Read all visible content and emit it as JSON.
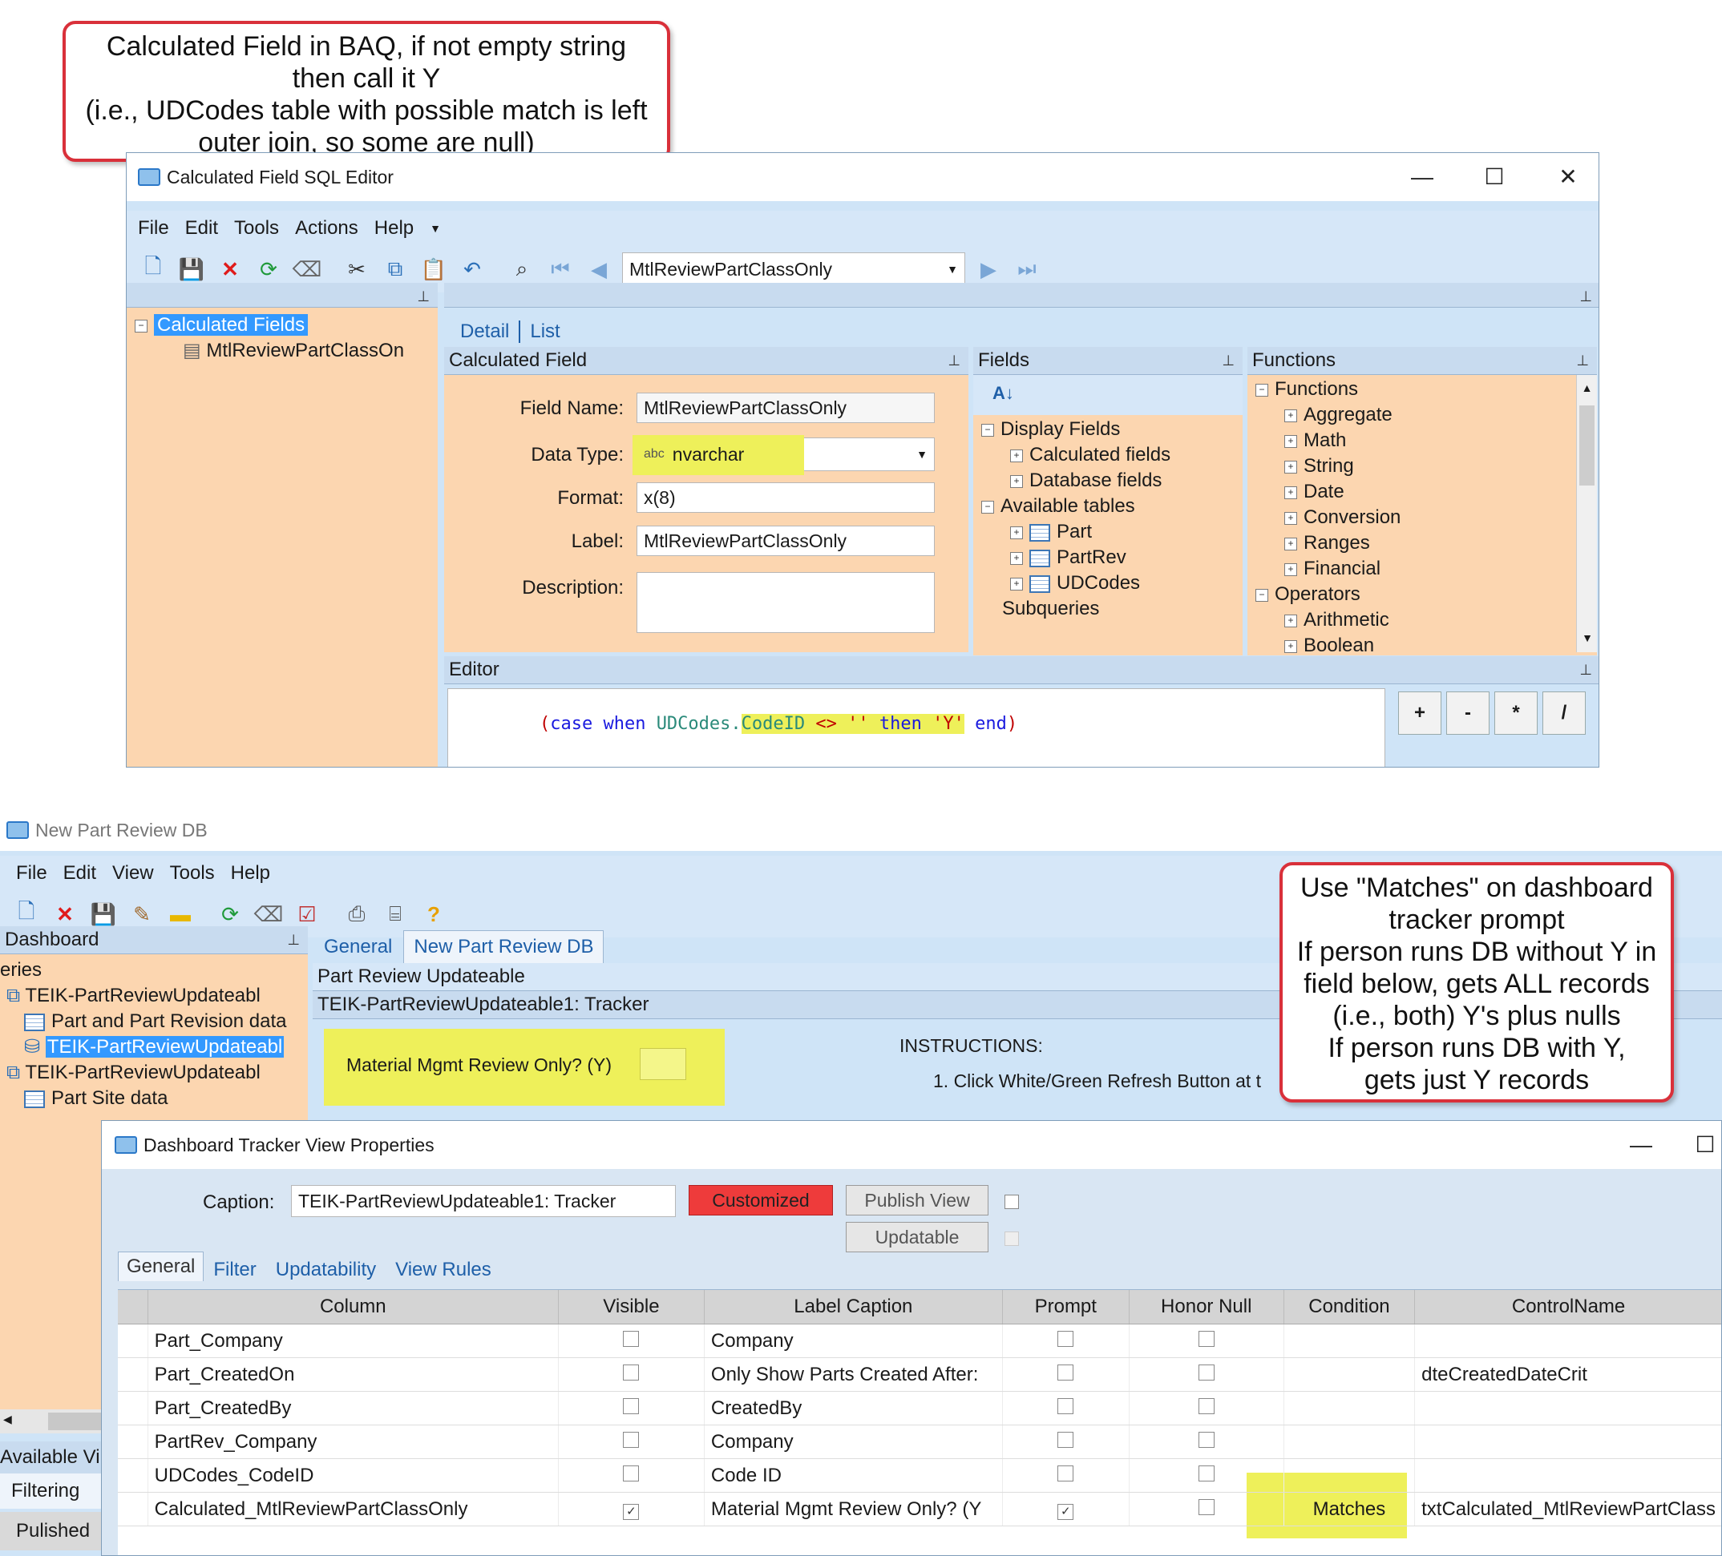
{
  "callout_top": {
    "lines": [
      "Calculated Field in BAQ, if not empty string",
      "then call it Y",
      "(i.e., UDCodes table with possible match is left",
      "outer join, so some are null)"
    ]
  },
  "editor_window": {
    "title": "Calculated Field SQL Editor",
    "menu": [
      "File",
      "Edit",
      "Tools",
      "Actions",
      "Help"
    ],
    "nav_value": "MtlReviewPartClassOnly",
    "tree_root": "Calculated Fields",
    "tree_child": "MtlReviewPartClassOn",
    "tabs": [
      "Detail",
      "List"
    ],
    "calc_panel_title": "Calculated Field",
    "field_name_label": "Field Name:",
    "field_name_value": "MtlReviewPartClassOnly",
    "data_type_label": "Data Type:",
    "data_type_prefix": "abc",
    "data_type_value": "nvarchar",
    "format_label": "Format:",
    "format_value": "x(8)",
    "label_label": "Label:",
    "label_value": "MtlReviewPartClassOnly",
    "description_label": "Description:",
    "fields_panel_title": "Fields",
    "fields_tree": {
      "display_fields": "Display Fields",
      "calculated_fields": "Calculated fields",
      "database_fields": "Database fields",
      "available_tables": "Available tables",
      "tables": [
        "Part",
        "PartRev",
        "UDCodes"
      ],
      "subqueries": "Subqueries"
    },
    "functions_panel_title": "Functions",
    "functions_tree": {
      "root": "Functions",
      "items": [
        "Aggregate",
        "Math",
        "String",
        "Date",
        "Conversion",
        "Ranges",
        "Financial"
      ],
      "operators": "Operators",
      "operator_items": [
        "Arithmetic",
        "Boolean"
      ]
    },
    "editor_title": "Editor",
    "code": {
      "open": "(",
      "case": "case",
      "when": "when",
      "table": "UDCodes.",
      "field": "CodeID",
      "op": "<>",
      "empty": "''",
      "then": "then",
      "y": "'Y'",
      "end": "end",
      "close": ")"
    },
    "operator_buttons": [
      "+",
      "-",
      "*",
      "/"
    ]
  },
  "dashboard_window": {
    "title": "New Part Review DB",
    "menu": [
      "File",
      "Edit",
      "View",
      "Tools",
      "Help"
    ],
    "left_title": "Dashboard",
    "left_section": "eries",
    "left_items": [
      "TEIK-PartReviewUpdateabl",
      "Part and Part Revision data",
      "TEIK-PartReviewUpdateabl",
      "TEIK-PartReviewUpdateabl",
      "Part Site data"
    ],
    "available_label": "Available Vi",
    "filtering_label": "Filtering",
    "published_label": "Pulished",
    "tabs": [
      "General",
      "New Part Review DB"
    ],
    "section1": "Part Review Updateable",
    "section2": "TEIK-PartReviewUpdateable1: Tracker",
    "prompt_label": "Material Mgmt Review Only? (Y)",
    "instructions_title": "INSTRUCTIONS:",
    "instruction_1": "1. Click White/Green Refresh Button at t"
  },
  "callout_right": {
    "lines": [
      "Use \"Matches\" on dashboard",
      "tracker prompt",
      "If person runs DB without Y in",
      "field below, gets ALL records",
      "(i.e., both) Y's plus nulls",
      "If person runs DB with Y,",
      "gets just Y records"
    ]
  },
  "properties_window": {
    "title": "Dashboard Tracker View Properties",
    "caption_label": "Caption:",
    "caption_value": "TEIK-PartReviewUpdateable1: Tracker",
    "customized_label": "Customized",
    "publish_label": "Publish View",
    "updatable_label": "Updatable",
    "tabs": [
      "General",
      "Filter",
      "Updatability",
      "View Rules"
    ],
    "columns": [
      "Column",
      "Visible",
      "Label Caption",
      "Prompt",
      "Honor Null",
      "Condition",
      "ControlName"
    ],
    "rows": [
      {
        "column": "Part_Company",
        "visible": "",
        "label": "Company",
        "prompt": "",
        "condition": "",
        "control": ""
      },
      {
        "column": "Part_CreatedOn",
        "visible": "",
        "label": "Only Show Parts Created After:",
        "prompt": "",
        "condition": "",
        "control": "dteCreatedDateCrit"
      },
      {
        "column": "Part_CreatedBy",
        "visible": "",
        "label": "CreatedBy",
        "prompt": "",
        "condition": "",
        "control": ""
      },
      {
        "column": "PartRev_Company",
        "visible": "",
        "label": "Company",
        "prompt": "",
        "condition": "",
        "control": ""
      },
      {
        "column": "UDCodes_CodeID",
        "visible": "",
        "label": "Code ID",
        "prompt": "",
        "condition": "",
        "control": ""
      },
      {
        "column": "Calculated_MtlReviewPartClassOnly",
        "visible": "✓",
        "label": "Material Mgmt Review Only? (Y",
        "prompt": "✓",
        "condition": "Matches",
        "control": "txtCalculated_MtlReviewPartClass"
      }
    ]
  },
  "colors": {
    "accent_blue": "#3399ff",
    "highlight_yellow": "#eef05a",
    "callout_red": "#d9303a",
    "panel_peach": "#fcd6b0",
    "customized_red": "#ee3b3b"
  }
}
